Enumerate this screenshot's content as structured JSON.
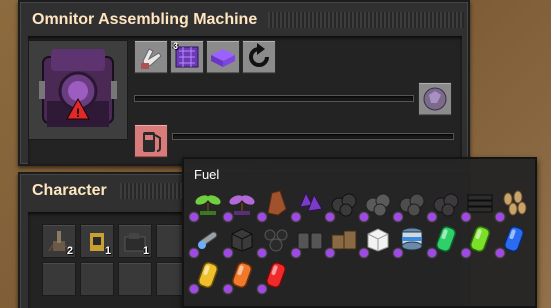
{
  "assembler": {
    "title": "Omnitor Assembling Machine",
    "recipe_slot_icon": "omnitor-machine-icon",
    "ingredients": [
      {
        "icon": "gloved-hand-icon"
      },
      {
        "icon": "purple-circuit-block-icon",
        "count_label": "3"
      },
      {
        "icon": "purple-plate-icon"
      },
      {
        "icon": "recipe-cycle-icon"
      }
    ],
    "output_icon": "omnite-ore-output-icon",
    "fuel_slot_icon": "fuel-pump-icon",
    "progress": 0,
    "fuel_progress": 0
  },
  "character": {
    "title": "Character",
    "slots": [
      {
        "icon": "turret-icon",
        "count": "2"
      },
      {
        "icon": "burner-drill-icon",
        "count": "1"
      },
      {
        "icon": "dark-machine-icon",
        "count": "1"
      }
    ]
  },
  "tooltip": {
    "title": "Fuel",
    "items": [
      "green-sprout-icon",
      "purple-sprout-icon",
      "wood-chunk-icon",
      "omnite-crystal-icon",
      "coal-ore-icon",
      "stone-rubble-icon",
      "crushed-rock-icon",
      "dark-rubble-icon",
      "coal-bricks-icon",
      "wood-pellets-icon",
      "wrench-tool-icon",
      "carbon-block-icon",
      "coal-lumps-icon",
      "barrel-stack-icon",
      "wooden-crates-icon",
      "white-block-icon",
      "blue-fuel-canister-icon",
      "green-fuel-cell-icon",
      "lime-fuel-cell-icon",
      "blue-fuel-cell-icon",
      "yellow-fuel-cell-icon",
      "orange-fuel-cell-icon",
      "red-fuel-cell-icon"
    ]
  },
  "colors": {
    "panel": "#313031",
    "title": "#ffe6c0",
    "fuel_slot": "#d97b7b",
    "quality_badge": "#a048e8"
  }
}
